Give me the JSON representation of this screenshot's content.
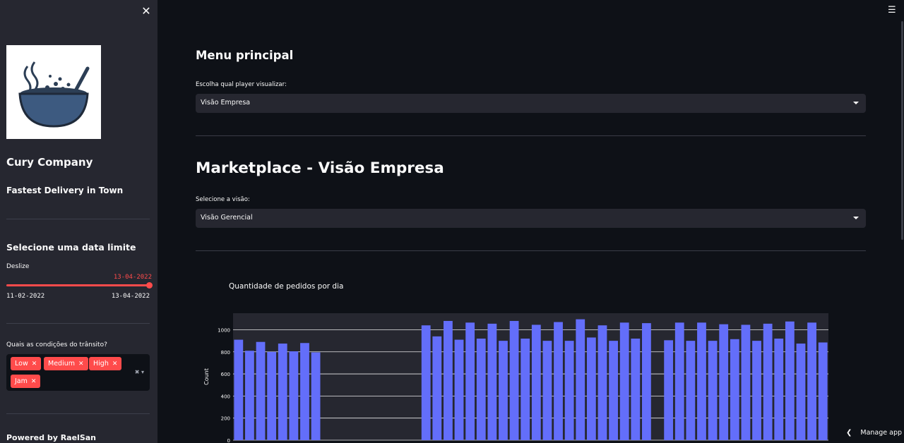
{
  "sidebar": {
    "close_icon": "close-icon",
    "brand": "Cury Company",
    "tagline": "Fastest Delivery in Town",
    "date_section_title": "Selecione uma data limite",
    "slider": {
      "label": "Deslize",
      "value": "13-04-2022",
      "min": "11-02-2022",
      "max": "13-04-2022",
      "fraction": 1.0
    },
    "traffic": {
      "label": "Quais as condições do trânsito?",
      "tags": [
        "Low",
        "Medium",
        "High",
        "Jam"
      ]
    },
    "footer": "Powered by RaelSan"
  },
  "main": {
    "menu_title": "Menu principal",
    "player_label": "Escolha qual player visualizar:",
    "player_value": "Visão Empresa",
    "page_title": "Marketplace - Visão Empresa",
    "view_label": "Selecione a visão:",
    "view_value": "Visão Gerencial",
    "manage_app": "Manage app"
  },
  "colors": {
    "accent": "#ff4b4b",
    "bar": "#636efa",
    "sidebar_bg": "#262730",
    "main_bg": "#0e1117",
    "plot_bg": "#262730"
  },
  "chart_data": {
    "type": "bar",
    "title": "Quantidade de pedidos por dia",
    "ylabel": "Count",
    "xlabel": "",
    "ylim": [
      0,
      1150
    ],
    "yticks": [
      0,
      200,
      400,
      600,
      800,
      1000
    ],
    "series": [
      {
        "values": [
          910,
          810,
          890,
          800,
          875,
          805,
          880,
          795,
          0,
          0,
          0,
          0,
          0,
          0,
          0,
          0,
          0,
          1040,
          940,
          1080,
          910,
          1065,
          920,
          1055,
          900,
          1080,
          920,
          1045,
          900,
          1070,
          900,
          1095,
          930,
          1040,
          900,
          1065,
          920,
          1060,
          0,
          905,
          1065,
          900,
          1065,
          900,
          1050,
          915,
          1045,
          900,
          1055,
          920,
          1075,
          875,
          1065,
          885
        ]
      }
    ]
  }
}
